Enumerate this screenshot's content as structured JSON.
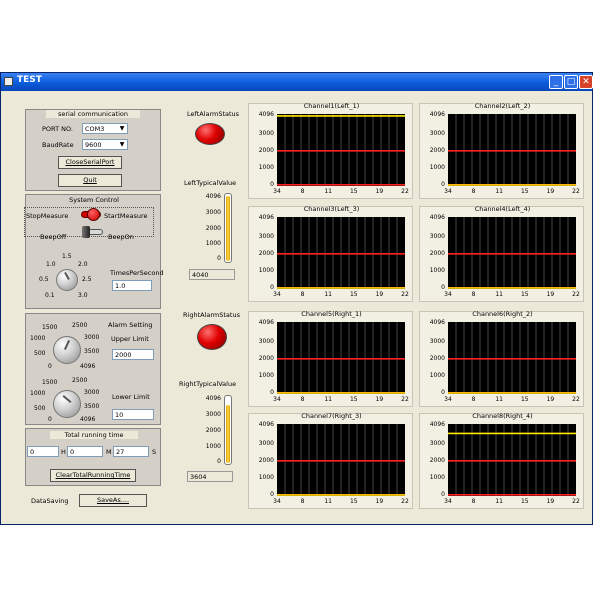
{
  "window": {
    "title": "TEST"
  },
  "serial": {
    "title": "serial communication",
    "port_label": "PORT NO.",
    "port_value": "COM3",
    "baud_label": "BaudRate",
    "baud_value": "9600",
    "close_btn": "CloseSerialPort",
    "quit_btn": "Quit"
  },
  "system": {
    "title": "System Control",
    "stop_label": "StopMeasure",
    "start_label": "StartMeasure",
    "beep_off": "BeepOff",
    "beep_on": "BeepOn",
    "tps_label": "TimesPerSecond",
    "tps_value": "1.0",
    "knob_ticks": [
      "1.0",
      "1.5",
      "2.0",
      "0.5",
      "2.5",
      "0.1",
      "3.0"
    ]
  },
  "alarm": {
    "title": "Alarm Setting",
    "upper_label": "Upper Limit",
    "upper_value": "2000",
    "lower_label": "Lower Limit",
    "lower_value": "10",
    "knob_ticks": [
      "1500",
      "2500",
      "1000",
      "3000",
      "500",
      "3500",
      "0",
      "4096"
    ]
  },
  "running": {
    "title": "Total running time",
    "h_value": "0",
    "h_unit": "H",
    "m_value": "0",
    "m_unit": "M",
    "s_value": "27",
    "s_unit": "S",
    "clear_btn": "ClearTotalRunningTime"
  },
  "saving": {
    "label": "DataSaving",
    "saveas_btn": "SaveAs...."
  },
  "left_status": {
    "alarm_label": "LeftAlarmStatus",
    "typical_label": "LeftTypicalValue",
    "typical_value": "4040",
    "fill": 0.986
  },
  "right_status": {
    "alarm_label": "RightAlarmStatus",
    "typical_label": "RightTypicalValue",
    "typical_value": "3604",
    "fill": 0.88
  },
  "thermo_ticks": [
    "4096",
    "3000",
    "2000",
    "1000",
    "0"
  ],
  "colors": {
    "threshold_upper": "#FF2020",
    "threshold_lower": "#FF2020",
    "signal": "#FFE800",
    "plot_bg": "#000000"
  },
  "chart_data": [
    {
      "type": "line",
      "title": "Channel1(Left_1)",
      "x": [
        34,
        8,
        11,
        15,
        19,
        22
      ],
      "ylim": [
        0,
        4096
      ],
      "yticks": [
        0,
        1000,
        2000,
        3000,
        4096
      ],
      "series": [
        {
          "values": [
            4040,
            4040,
            4040,
            4040,
            4040,
            4040
          ]
        }
      ],
      "thresholds": [
        2000,
        10
      ]
    },
    {
      "type": "line",
      "title": "Channel2(Left_2)",
      "x": [
        34,
        8,
        11,
        15,
        19,
        22
      ],
      "ylim": [
        0,
        4096
      ],
      "yticks": [
        0,
        1000,
        2000,
        3000,
        4096
      ],
      "series": [
        {
          "values": [
            0,
            0,
            0,
            0,
            0,
            0
          ]
        }
      ],
      "thresholds": [
        2000,
        10
      ]
    },
    {
      "type": "line",
      "title": "Channel3(Left_3)",
      "x": [
        34,
        8,
        11,
        15,
        19,
        22
      ],
      "ylim": [
        0,
        4096
      ],
      "yticks": [
        0,
        1000,
        2000,
        3000,
        4096
      ],
      "series": [
        {
          "values": [
            0,
            0,
            0,
            0,
            0,
            0
          ]
        }
      ],
      "thresholds": [
        2000,
        10
      ]
    },
    {
      "type": "line",
      "title": "Channel4(Left_4)",
      "x": [
        34,
        8,
        11,
        15,
        19,
        22
      ],
      "ylim": [
        0,
        4096
      ],
      "yticks": [
        0,
        1000,
        2000,
        3000,
        4096
      ],
      "series": [
        {
          "values": [
            0,
            0,
            0,
            0,
            0,
            0
          ]
        }
      ],
      "thresholds": [
        2000,
        10
      ]
    },
    {
      "type": "line",
      "title": "Channel5(Right_1)",
      "x": [
        34,
        8,
        11,
        15,
        19,
        22
      ],
      "ylim": [
        0,
        4096
      ],
      "yticks": [
        0,
        1000,
        2000,
        3000,
        4096
      ],
      "series": [
        {
          "values": [
            0,
            0,
            0,
            0,
            0,
            0
          ]
        }
      ],
      "thresholds": [
        2000,
        10
      ]
    },
    {
      "type": "line",
      "title": "Channel6(Right_2)",
      "x": [
        34,
        8,
        11,
        15,
        19,
        22
      ],
      "ylim": [
        0,
        4096
      ],
      "yticks": [
        0,
        1000,
        2000,
        3000,
        4096
      ],
      "series": [
        {
          "values": [
            0,
            0,
            0,
            0,
            0,
            0
          ]
        }
      ],
      "thresholds": [
        2000,
        10
      ]
    },
    {
      "type": "line",
      "title": "Channel7(Right_3)",
      "x": [
        34,
        8,
        11,
        15,
        19,
        22
      ],
      "ylim": [
        0,
        4096
      ],
      "yticks": [
        0,
        1000,
        2000,
        3000,
        4096
      ],
      "series": [
        {
          "values": [
            0,
            0,
            0,
            0,
            0,
            0
          ]
        }
      ],
      "thresholds": [
        2000,
        10
      ]
    },
    {
      "type": "line",
      "title": "Channel8(Right_4)",
      "x": [
        34,
        8,
        11,
        15,
        19,
        22
      ],
      "ylim": [
        0,
        4096
      ],
      "yticks": [
        0,
        1000,
        2000,
        3000,
        4096
      ],
      "series": [
        {
          "values": [
            3604,
            3604,
            3604,
            3604,
            3604,
            3604
          ]
        }
      ],
      "thresholds": [
        2000,
        10
      ]
    }
  ]
}
